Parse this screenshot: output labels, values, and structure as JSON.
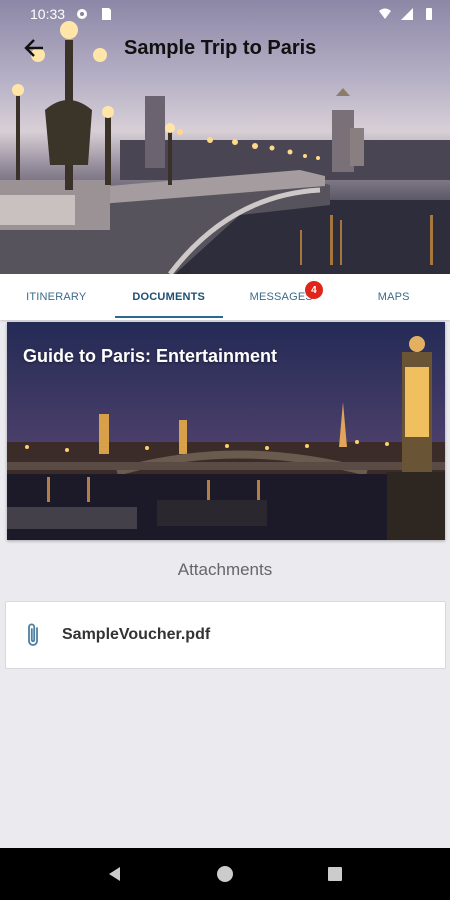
{
  "status_bar": {
    "time": "10:33"
  },
  "app_bar": {
    "title": "Sample Trip to Paris"
  },
  "tabs": [
    {
      "label": "ITINERARY",
      "active": false
    },
    {
      "label": "DOCUMENTS",
      "active": true
    },
    {
      "label": "MESSAGES",
      "active": false,
      "badge": "4"
    },
    {
      "label": "MAPS",
      "active": false
    }
  ],
  "guide": {
    "title": "Guide to Paris: Entertainment"
  },
  "attachments": {
    "heading": "Attachments",
    "items": [
      {
        "name": "SampleVoucher.pdf",
        "icon": "paperclip-icon"
      }
    ]
  },
  "colors": {
    "accent": "#2a6a8c",
    "badge": "#e0261a",
    "background": "#ebeaef"
  }
}
